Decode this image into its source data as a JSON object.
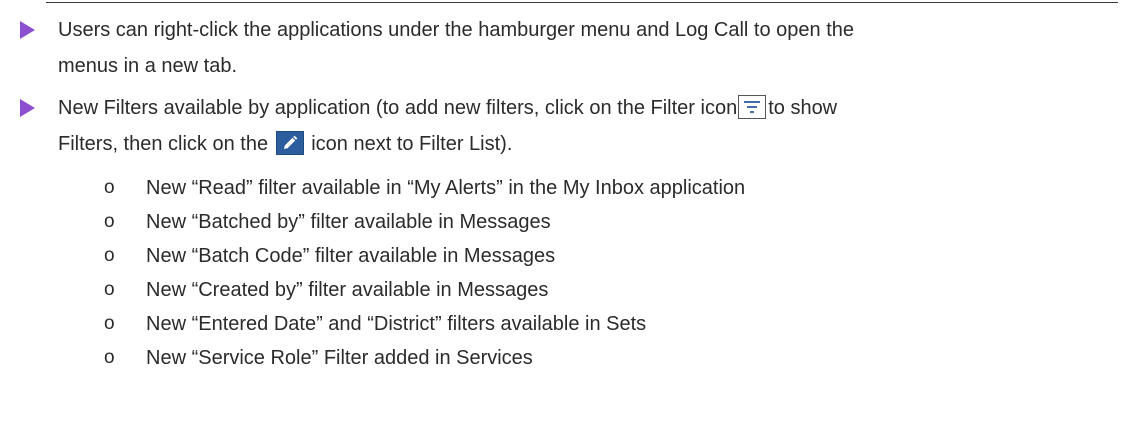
{
  "bullets": [
    {
      "lines": [
        "Users can right-click the applications under the hamburger menu and Log Call to open the",
        "menus in a new tab."
      ]
    },
    {
      "line1_before_icon": "New Filters available by application (to add new filters, click on the Filter icon",
      "line1_after_icon": "to show",
      "line2_before_icon": "Filters, then click on the",
      "line2_after_icon": "icon next to Filter List).",
      "icons": [
        "filter-icon",
        "edit-icon"
      ]
    }
  ],
  "sub_marker": "o",
  "sub_items": [
    "New “Read” filter available in “My Alerts” in the My Inbox application",
    "New “Batched by” filter available in Messages",
    "New “Batch Code” filter available in Messages",
    "New “Created by” filter available in Messages",
    "New “Entered Date” and “District” filters available in Sets",
    "New “Service Role” Filter added in Services"
  ],
  "colors": {
    "bullet_arrow": "#8c4fd0",
    "edit_icon_bg": "#2c5e9e",
    "text": "#2b2b2b"
  }
}
